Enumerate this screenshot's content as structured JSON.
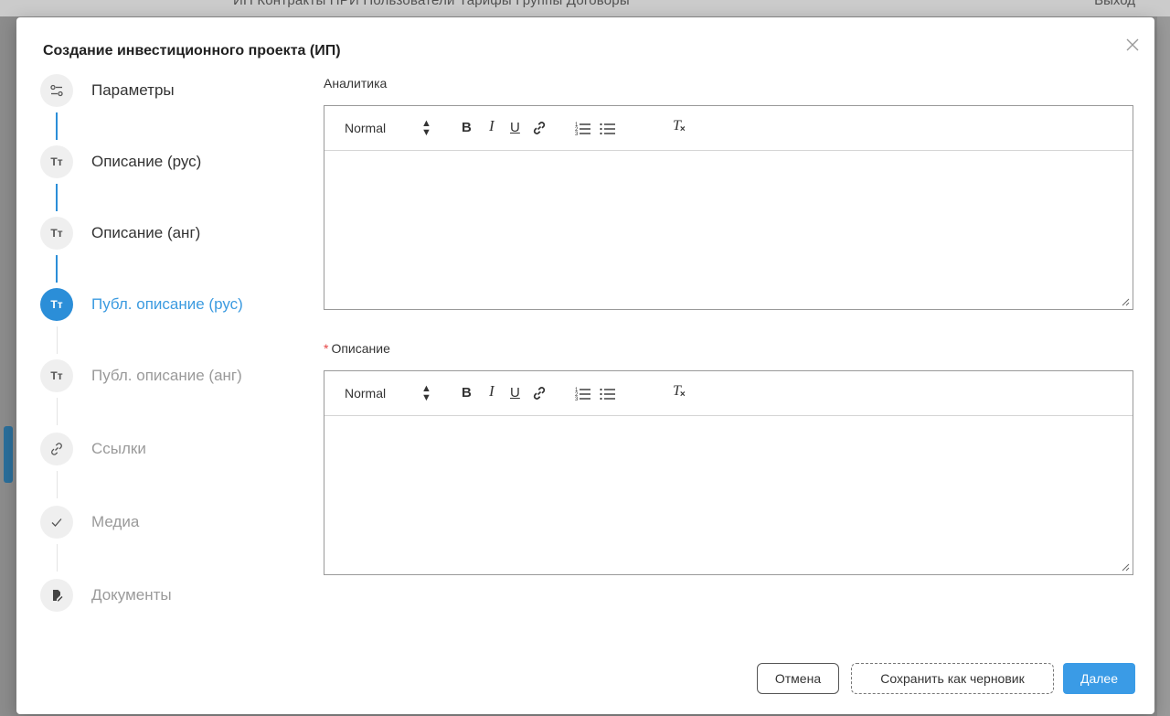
{
  "background": {
    "nav_text": "ИП    Контракты    ПРИ    Пользователи    Тарифы    Группы    Договоры",
    "right_text": "Выход"
  },
  "modal": {
    "title": "Создание инвестиционного проекта (ИП)",
    "close_icon": "close-icon"
  },
  "steps": [
    {
      "label": "Параметры",
      "icon": "sliders-icon",
      "icon_text": "",
      "state": "done"
    },
    {
      "label": "Описание (рус)",
      "icon": "text-size-icon",
      "icon_text": "Tт",
      "state": "done"
    },
    {
      "label": "Описание (анг)",
      "icon": "text-size-icon",
      "icon_text": "Tт",
      "state": "done"
    },
    {
      "label": "Публ. описание (рус)",
      "icon": "text-size-icon",
      "icon_text": "Tт",
      "state": "active"
    },
    {
      "label": "Публ. описание (анг)",
      "icon": "text-size-icon",
      "icon_text": "Tт",
      "state": "pending"
    },
    {
      "label": "Ссылки",
      "icon": "link-icon",
      "icon_text": "",
      "state": "pending"
    },
    {
      "label": "Медиа",
      "icon": "check-icon",
      "icon_text": "",
      "state": "pending"
    },
    {
      "label": "Документы",
      "icon": "document-edit-icon",
      "icon_text": "",
      "state": "pending"
    }
  ],
  "fields": {
    "analytics": {
      "label": "Аналитика",
      "required": false,
      "value": ""
    },
    "description": {
      "label": "Описание",
      "required": true,
      "value": "",
      "required_mark": "*"
    }
  },
  "toolbar": {
    "header_select": "Normal",
    "bold": "B",
    "italic": "I",
    "underline": "U",
    "clear": "T"
  },
  "footer": {
    "cancel_label": "Отмена",
    "draft_label": "Сохранить как черновик",
    "next_label": "Далее"
  },
  "colors": {
    "accent": "#2b8ed8",
    "required": "#e64545",
    "primary_button": "#3a9be6"
  }
}
